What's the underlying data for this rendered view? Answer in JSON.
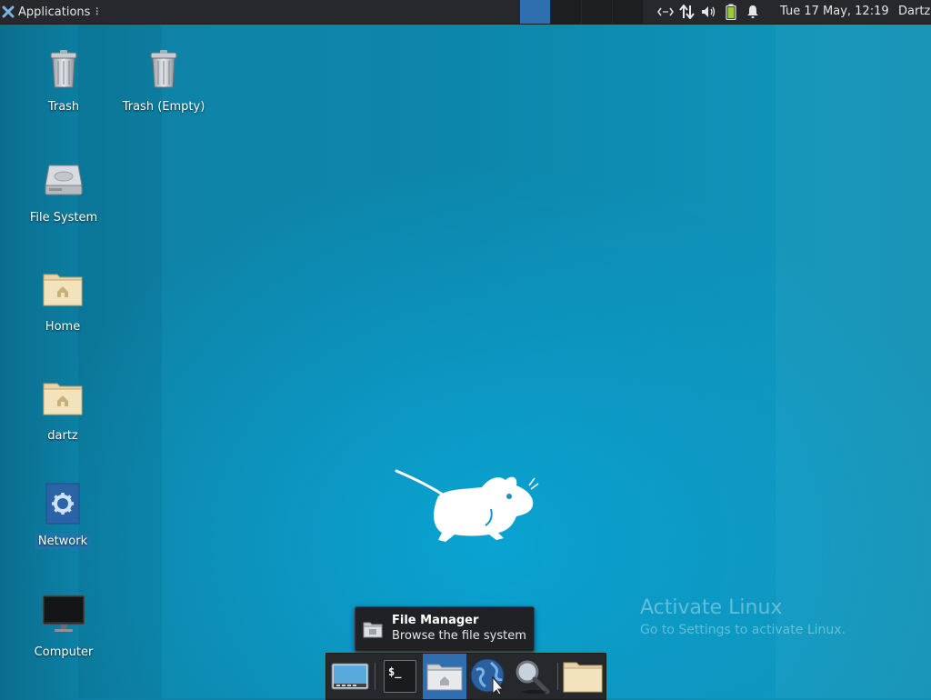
{
  "top_panel": {
    "applications_label": "Applications",
    "applications_dots": "⠇",
    "clock": "Tue 17 May, 12:19",
    "user": "Dartz",
    "tray_icons": [
      "network-switch-icon",
      "network-transfer-icon",
      "volume-icon",
      "battery-icon",
      "notification-bell-icon"
    ]
  },
  "desktop_icons": [
    {
      "label": "Trash",
      "icon": "trash-icon"
    },
    {
      "label": "Trash (Empty)",
      "icon": "trash-icon"
    },
    {
      "label": "File System",
      "icon": "drive-icon"
    },
    {
      "label": "Home",
      "icon": "home-folder-icon"
    },
    {
      "label": "dartz",
      "icon": "home-folder-icon"
    },
    {
      "label": "Network",
      "icon": "network-gear-icon"
    },
    {
      "label": "Computer",
      "icon": "monitor-icon"
    }
  ],
  "watermark": {
    "title": "Activate Linux",
    "subtitle": "Go to Settings to activate Linux."
  },
  "tooltip": {
    "title": "File Manager",
    "subtitle": "Browse the file system"
  },
  "dock": {
    "items": [
      "show-desktop-icon",
      "terminal-icon",
      "file-manager-icon",
      "web-browser-icon",
      "search-icon",
      "folder-icon"
    ],
    "terminal_glyph": "$_"
  },
  "colors": {
    "panel": "#26282b",
    "accent": "#2f6fb0",
    "desktop": "#0d86ab"
  }
}
